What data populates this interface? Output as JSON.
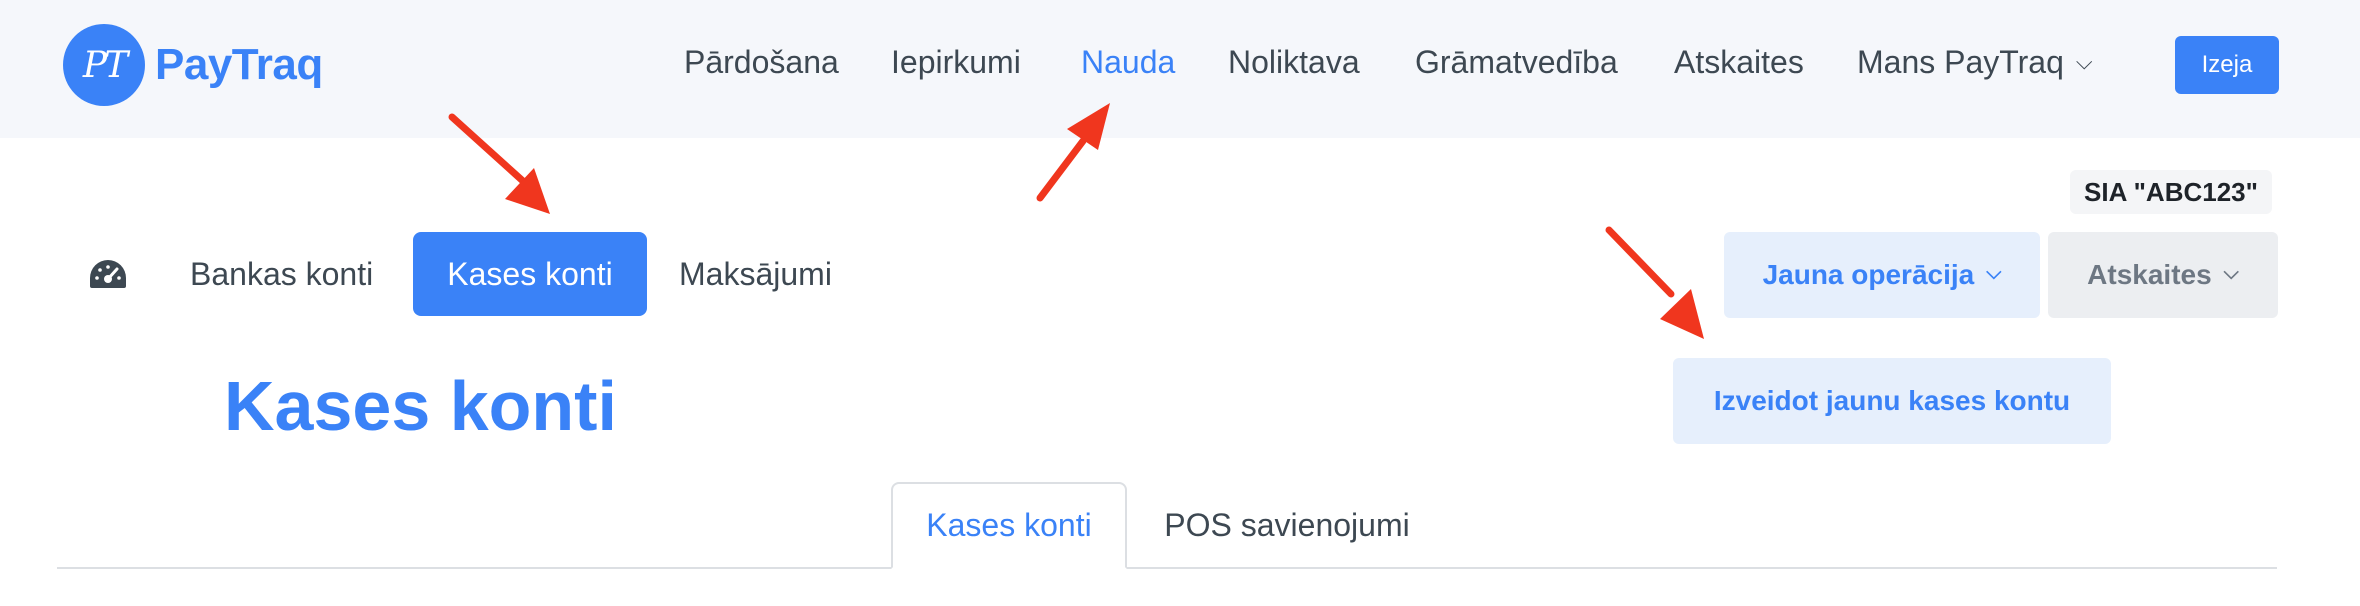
{
  "brand": {
    "logo_mark": "PT",
    "name": "PayTraq",
    "accent_color": "#3a82f7"
  },
  "topnav": {
    "items": [
      {
        "label": "Pārdošana"
      },
      {
        "label": "Iepirkumi"
      },
      {
        "label": "Nauda",
        "active": true
      },
      {
        "label": "Noliktava"
      },
      {
        "label": "Grāmatvedība"
      },
      {
        "label": "Atskaites"
      },
      {
        "label": "Mans PayTraq",
        "has_dropdown": true
      }
    ],
    "exit_label": "Izeja"
  },
  "company": "SIA \"ABC123\"",
  "subnav": {
    "dashboard_icon": "gauge-icon",
    "items": [
      {
        "label": "Bankas konti"
      },
      {
        "label": "Kases konti",
        "active": true
      },
      {
        "label": "Maksājumi"
      }
    ]
  },
  "actions": {
    "new_operation": "Jauna operācija",
    "reports": "Atskaites",
    "create_cash_account": "Izveidot jaunu kases kontu"
  },
  "page": {
    "title": "Kases konti"
  },
  "tabs": [
    {
      "label": "Kases konti",
      "active": true
    },
    {
      "label": "POS savienojumi"
    }
  ],
  "annotation": {
    "arrow_color": "#f0361e",
    "arrow_count": 3
  }
}
